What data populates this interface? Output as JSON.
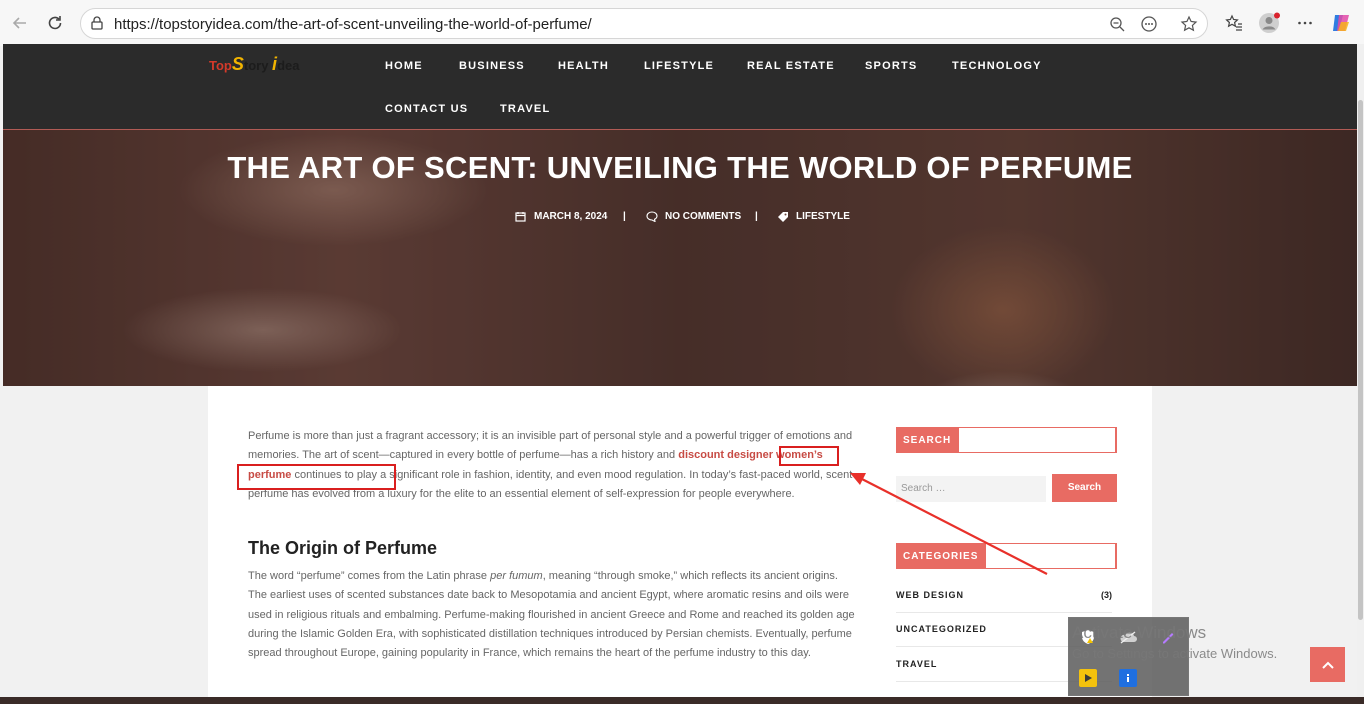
{
  "browser": {
    "url": "https://topstoryidea.com/the-art-of-scent-unveiling-the-world-of-perfume/"
  },
  "site": {
    "logo_part1": "Top",
    "logo_part2": "S",
    "logo_part3": "tory ",
    "logo_part4": "i",
    "logo_part5": "dea",
    "nav": [
      "HOME",
      "BUSINESS",
      "HEALTH",
      "LIFESTYLE",
      "REAL ESTATE",
      "SPORTS",
      "TECHNOLOGY",
      "CONTACT US",
      "TRAVEL"
    ]
  },
  "hero": {
    "title": "THE ART OF SCENT: UNVEILING THE WORLD OF PERFUME",
    "date": "MARCH 8, 2024",
    "comments": "NO COMMENTS",
    "category": "LIFESTYLE",
    "separator": "|"
  },
  "article": {
    "p1_before": "Perfume is more than just a fragrant accessory; it is an invisible part of personal style and a powerful trigger of emotions and memories. The art of scent—captured in every bottle of perfume—has a rich history and ",
    "p1_link": "discount designer women’s perfume",
    "p1_after": " continues to play a significant role in fashion, identity, and even mood regulation. In today’s fast-paced world, scent perfume has evolved from a luxury for the elite to an essential element of self-expression for people everywhere.",
    "h2": "The Origin of Perfume",
    "p2_before": "The word “perfume” comes from the Latin phrase ",
    "p2_italic": "per fumum",
    "p2_after": ", meaning “through smoke,” which reflects its ancient origins. The earliest uses of scented substances date back to Mesopotamia and ancient Egypt, where aromatic resins and oils were used in religious rituals and embalming. Perfume-making flourished in ancient Greece and Rome and reached its golden age during the Islamic Golden Era, with sophisticated distillation techniques introduced by Persian chemists. Eventually, perfume spread throughout Europe, gaining popularity in France, which remains the heart of the perfume industry to this day."
  },
  "sidebar": {
    "search_title": "SEARCH",
    "search_placeholder": "Search …",
    "search_button": "Search",
    "categories_title": "CATEGORIES",
    "categories": [
      {
        "name": "WEB DESIGN",
        "count": "(3)"
      },
      {
        "name": "UNCATEGORIZED",
        "count": ""
      },
      {
        "name": "TRAVEL",
        "count": ""
      }
    ]
  },
  "os": {
    "activate_title": "Activate Windows",
    "activate_sub": "Go to Settings to activate Windows."
  },
  "colors": {
    "accent": "#e86b63",
    "annotation": "#d91f1f",
    "header": "#2b2b2b"
  }
}
